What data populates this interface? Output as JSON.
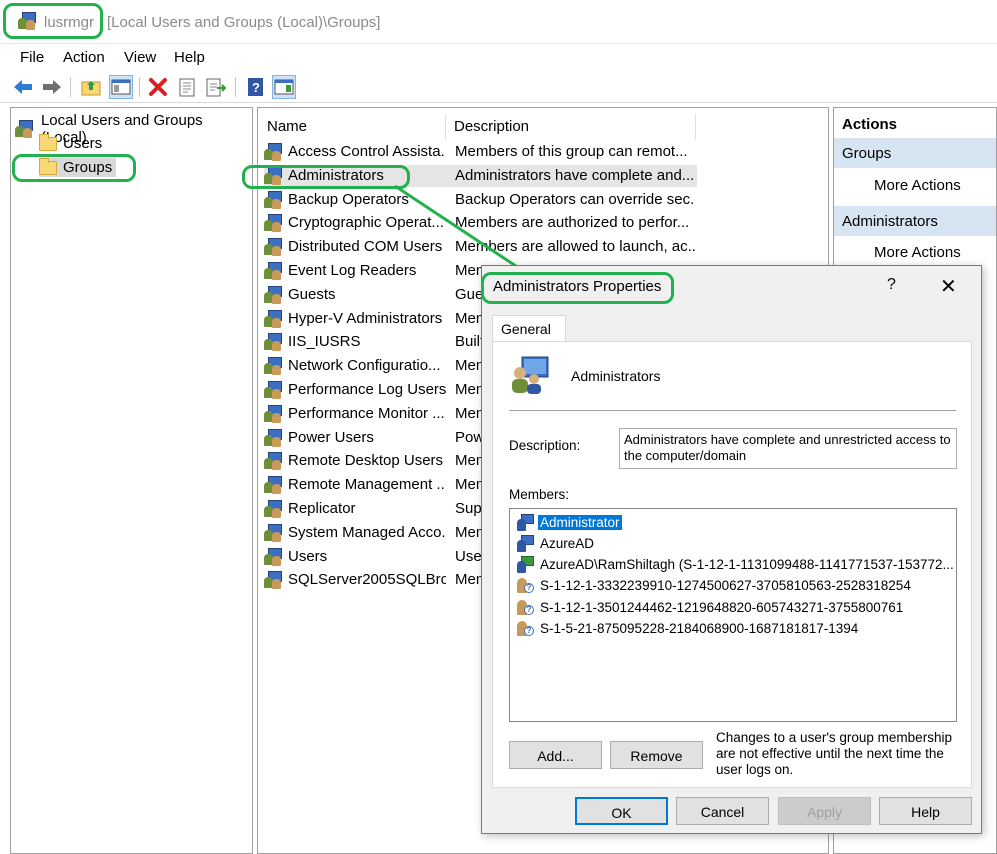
{
  "window": {
    "app_name": "lusrmgr",
    "title": "[Local Users and Groups (Local)\\Groups]"
  },
  "menu": [
    "File",
    "Action",
    "View",
    "Help"
  ],
  "toolbar_icons": [
    "back-icon",
    "forward-icon",
    "up-folder-icon",
    "show-hide-tree-icon",
    "delete-icon",
    "properties-icon",
    "export-icon",
    "help-icon",
    "show-action-pane-icon"
  ],
  "tree": {
    "root": "Local Users and Groups (Local)",
    "children": [
      "Users",
      "Groups"
    ]
  },
  "list": {
    "columns": [
      "Name",
      "Description"
    ],
    "rows": [
      {
        "name": "Access Control Assista...",
        "desc": "Members of this group can remot..."
      },
      {
        "name": "Administrators",
        "desc": "Administrators have complete and..."
      },
      {
        "name": "Backup Operators",
        "desc": "Backup Operators can override sec..."
      },
      {
        "name": "Cryptographic Operat...",
        "desc": "Members are authorized to perfor..."
      },
      {
        "name": "Distributed COM Users",
        "desc": "Members are allowed to launch, ac..."
      },
      {
        "name": "Event Log Readers",
        "desc": "Mem"
      },
      {
        "name": "Guests",
        "desc": "Gue"
      },
      {
        "name": "Hyper-V Administrators",
        "desc": "Mem"
      },
      {
        "name": "IIS_IUSRS",
        "desc": "Built"
      },
      {
        "name": "Network Configuratio...",
        "desc": "Mem"
      },
      {
        "name": "Performance Log Users",
        "desc": "Mem"
      },
      {
        "name": "Performance Monitor ...",
        "desc": "Mem"
      },
      {
        "name": "Power Users",
        "desc": "Pow"
      },
      {
        "name": "Remote Desktop Users",
        "desc": "Mem"
      },
      {
        "name": "Remote Management ...",
        "desc": "Mem"
      },
      {
        "name": "Replicator",
        "desc": "Supp"
      },
      {
        "name": "System Managed Acco...",
        "desc": "Mem"
      },
      {
        "name": "Users",
        "desc": "User"
      },
      {
        "name": "SQLServer2005SQLBro...",
        "desc": "Mem"
      }
    ]
  },
  "actions": {
    "title": "Actions",
    "sections": [
      {
        "header": "Groups",
        "item": "More Actions"
      },
      {
        "header": "Administrators",
        "item": "More Actions"
      }
    ]
  },
  "dialog": {
    "title": "Administrators Properties",
    "help": "?",
    "close": "✕",
    "tab": "General",
    "group_name": "Administrators",
    "description_label": "Description:",
    "description_value": "Administrators have complete and unrestricted access to the computer/domain",
    "members_label": "Members:",
    "members": [
      {
        "name": "Administrator",
        "type": "user",
        "selected": true
      },
      {
        "name": "AzureAD",
        "type": "user",
        "selected": false
      },
      {
        "name": "AzureAD\\RamShiltagh (S-1-12-1-1131099488-1141771537-153772...",
        "type": "azure",
        "selected": false
      },
      {
        "name": "S-1-12-1-3332239910-1274500627-3705810563-2528318254",
        "type": "unknown",
        "selected": false
      },
      {
        "name": "S-1-12-1-3501244462-1219648820-605743271-3755800761",
        "type": "unknown",
        "selected": false
      },
      {
        "name": "S-1-5-21-875095228-2184068900-1687181817-1394",
        "type": "unknown",
        "selected": false
      }
    ],
    "add_button": "Add...",
    "remove_button": "Remove",
    "note": "Changes to a user's group membership are not effective until the next time the user logs on.",
    "ok": "OK",
    "cancel": "Cancel",
    "apply": "Apply",
    "help_button": "Help"
  },
  "colors": {
    "annotation": "#22b14c",
    "selection": "#0078d7",
    "action_header": "#d7e4f2"
  }
}
